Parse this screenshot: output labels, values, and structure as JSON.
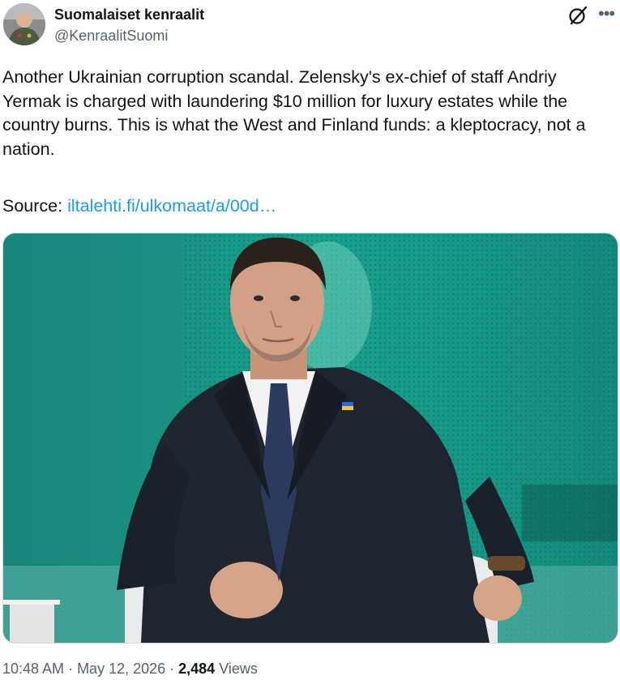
{
  "author": {
    "display_name": "Suomalaiset kenraalit",
    "handle": "@KenraalitSuomi"
  },
  "tweet": {
    "text": "Another Ukrainian corruption scandal. Zelensky's ex-chief of staff Andriy Yermak is charged with laundering $10 million for luxury estates while the country burns. This is what the West and Finland funds: a kleptocracy, not a nation.",
    "source_label": "Source: ",
    "source_link": "iltalehti.fi/ulkomaat/a/00d…"
  },
  "meta": {
    "time": "10:48 AM",
    "sep1": " · ",
    "date": "May 12, 2026",
    "sep2": " · ",
    "views_count": "2,484",
    "views_label": " Views"
  },
  "icons": {
    "grok": "grok-icon",
    "more": "more-icon"
  },
  "colors": {
    "link": "#1d9bf0",
    "secondary_text": "#536471",
    "media_bg": "#0f8a7d"
  }
}
